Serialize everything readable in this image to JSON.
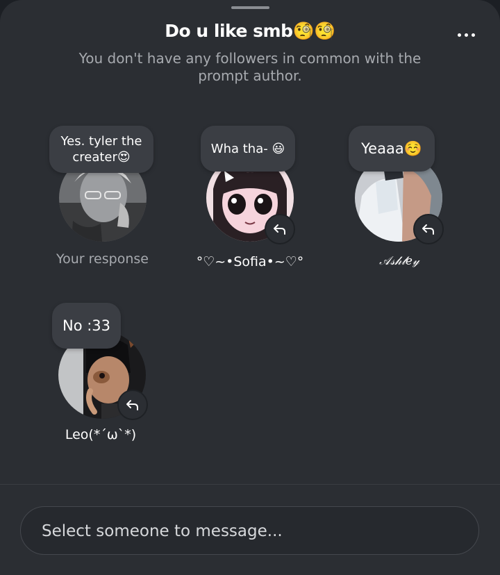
{
  "header": {
    "title": "Do u like smb🧐🧐",
    "subtitle": "You don't have any followers in common with the prompt author."
  },
  "responses": [
    {
      "bubble": "Yes. tyler the creater😍",
      "name": "Your response",
      "avatar_icon": "user-avatar-photo"
    },
    {
      "bubble": "Wha tha- 😃",
      "name": "°♡~•Sofia•~♡°",
      "avatar_icon": "anime-girl-avatar"
    },
    {
      "bubble": "Yeaaa☺️",
      "name": "𝒜𝓈𝒽𝓁𝑒𝓎",
      "avatar_icon": "avatar-photo"
    },
    {
      "bubble": "No :33",
      "name": "Leo(*´ω`*)",
      "avatar_icon": "dog-filter-avatar"
    }
  ],
  "composer": {
    "placeholder": "Select someone to message..."
  },
  "icons": {
    "reply": "reply-arrow-icon",
    "more": "more-options-icon"
  },
  "colors": {
    "sheet": "#2b2e33",
    "bubble": "#3b3e44",
    "muted_text": "#a7aaaf"
  }
}
